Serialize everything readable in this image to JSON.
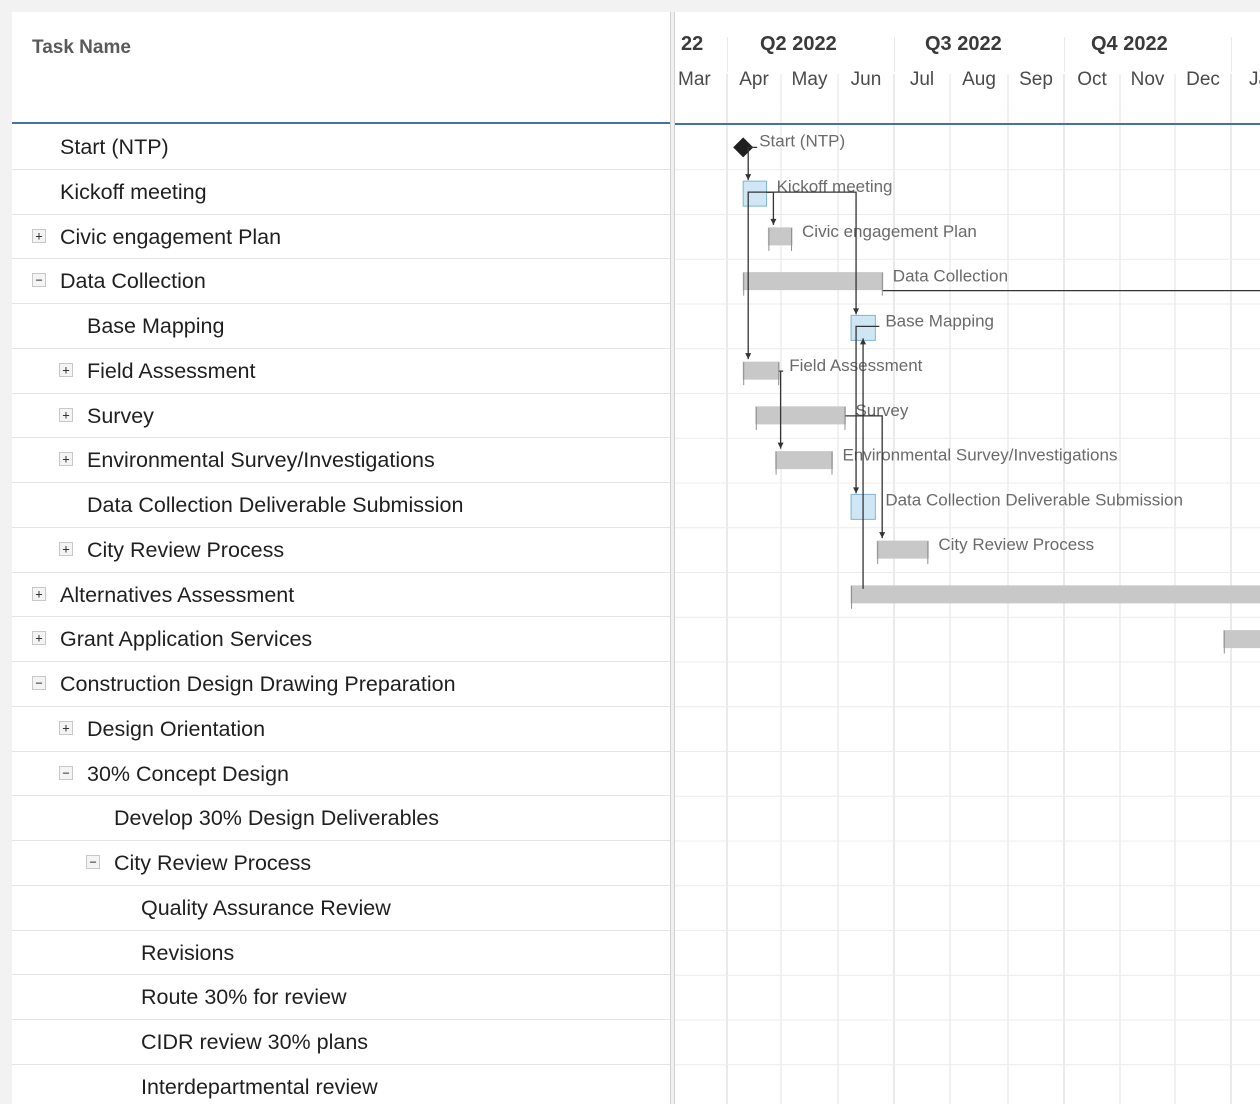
{
  "grid": {
    "header": "Task Name",
    "rows": [
      {
        "label": "Start (NTP)",
        "level": 0,
        "toggle": ""
      },
      {
        "label": "Kickoff meeting",
        "level": 0,
        "toggle": ""
      },
      {
        "label": "Civic engagement Plan",
        "level": 0,
        "toggle": "+"
      },
      {
        "label": "Data Collection",
        "level": 0,
        "toggle": "−"
      },
      {
        "label": "Base Mapping",
        "level": 1,
        "toggle": ""
      },
      {
        "label": "Field Assessment",
        "level": 1,
        "toggle": "+"
      },
      {
        "label": "Survey",
        "level": 1,
        "toggle": "+"
      },
      {
        "label": "Environmental Survey/Investigations",
        "level": 1,
        "toggle": "+"
      },
      {
        "label": "Data Collection Deliverable Submission",
        "level": 1,
        "toggle": ""
      },
      {
        "label": "City Review Process",
        "level": 1,
        "toggle": "+"
      },
      {
        "label": "Alternatives Assessment",
        "level": 0,
        "toggle": "+"
      },
      {
        "label": "Grant Application Services",
        "level": 0,
        "toggle": "+"
      },
      {
        "label": "Construction Design Drawing Preparation",
        "level": 0,
        "toggle": "−"
      },
      {
        "label": "Design Orientation",
        "level": 1,
        "toggle": "+"
      },
      {
        "label": "30% Concept Design",
        "level": 1,
        "toggle": "−"
      },
      {
        "label": "Develop 30% Design Deliverables",
        "level": 2,
        "toggle": ""
      },
      {
        "label": "City Review Process",
        "level": 2,
        "toggle": "−"
      },
      {
        "label": "Quality Assurance Review",
        "level": 3,
        "toggle": ""
      },
      {
        "label": "Revisions",
        "level": 3,
        "toggle": ""
      },
      {
        "label": "Route 30% for review",
        "level": 3,
        "toggle": ""
      },
      {
        "label": "CIDR review 30% plans",
        "level": 3,
        "toggle": ""
      },
      {
        "label": "Interdepartmental review",
        "level": 3,
        "toggle": ""
      }
    ]
  },
  "timeline": {
    "quarters": [
      "22",
      "Q2 2022",
      "Q3 2022",
      "Q4 2022"
    ],
    "months": [
      "Mar",
      "Apr",
      "May",
      "Jun",
      "Jul",
      "Aug",
      "Sep",
      "Oct",
      "Nov",
      "Dec",
      "Ja"
    ]
  },
  "chart_data": {
    "type": "gantt",
    "time_unit": "month",
    "axis_start": "2022-03-01",
    "bars": [
      {
        "task": "Start (NTP)",
        "kind": "milestone",
        "start": "2022-04-10",
        "label": "Start (NTP)"
      },
      {
        "task": "Kickoff meeting",
        "kind": "task",
        "start": "2022-04-10",
        "end": "2022-04-23",
        "label": "Kickoff meeting"
      },
      {
        "task": "Civic engagement Plan",
        "kind": "summary",
        "start": "2022-04-24",
        "end": "2022-05-07",
        "label": "Civic engagement Plan"
      },
      {
        "task": "Data Collection",
        "kind": "summary",
        "start": "2022-04-10",
        "end": "2022-06-25",
        "label": "Data Collection"
      },
      {
        "task": "Base Mapping",
        "kind": "task",
        "start": "2022-06-08",
        "end": "2022-06-21",
        "label": "Base Mapping"
      },
      {
        "task": "Field Assessment",
        "kind": "summary",
        "start": "2022-04-10",
        "end": "2022-04-30",
        "label": "Field Assessment"
      },
      {
        "task": "Survey",
        "kind": "summary",
        "start": "2022-04-17",
        "end": "2022-06-05",
        "label": "Survey"
      },
      {
        "task": "Environmental Survey/Investigations",
        "kind": "summary",
        "start": "2022-04-28",
        "end": "2022-05-29",
        "label": "Environmental Survey/Investigations"
      },
      {
        "task": "Data Collection Deliverable Submission",
        "kind": "task",
        "start": "2022-06-08",
        "end": "2022-06-21",
        "label": "Data Collection Deliverable Submission"
      },
      {
        "task": "City Review Process",
        "kind": "summary",
        "start": "2022-06-22",
        "end": "2022-07-20",
        "label": "City Review Process"
      },
      {
        "task": "Alternatives Assessment",
        "kind": "summary",
        "start": "2022-06-08",
        "end": "2023-01-31",
        "label": ""
      },
      {
        "task": "Grant Application Services",
        "kind": "summary",
        "start": "2022-12-28",
        "end": "2023-01-31",
        "label": ""
      }
    ]
  },
  "colors": {
    "task_bar": "#cfe6f5",
    "task_bar_border": "#7fb3d8",
    "summary_bar": "#c8c8c8",
    "summary_border": "#8f8f8f",
    "header_rule": "#4a6fa5",
    "grid_line": "#e3e3e3",
    "link": "#333333"
  }
}
